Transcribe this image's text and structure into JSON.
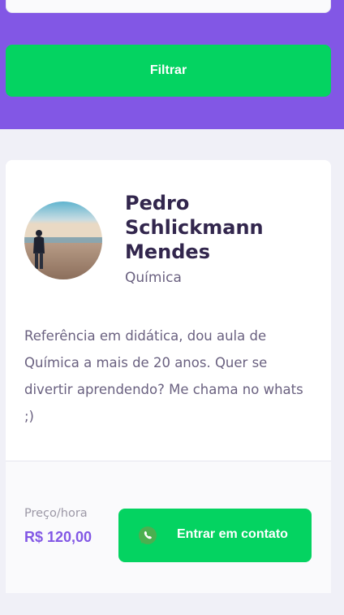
{
  "filters": {
    "submit_label": "Filtrar"
  },
  "teacher": {
    "name": "Pedro Schlickmann Mendes",
    "subject": "Química",
    "bio": "Referência em didática, dou aula de Química a mais de 20 anos. Quer se divertir aprendendo? Me chama no whats ;)",
    "price_label": "Preço/hora",
    "price_value": "R$ 120,00",
    "contact_label": "Entrar em contato",
    "avatar_icon": "beach-person-photo",
    "contact_icon": "whatsapp-icon"
  },
  "colors": {
    "primary": "#8257E5",
    "secondary": "#04D361",
    "background": "#F0F0F7",
    "title_text": "#32264D",
    "body_text": "#6A6180"
  }
}
